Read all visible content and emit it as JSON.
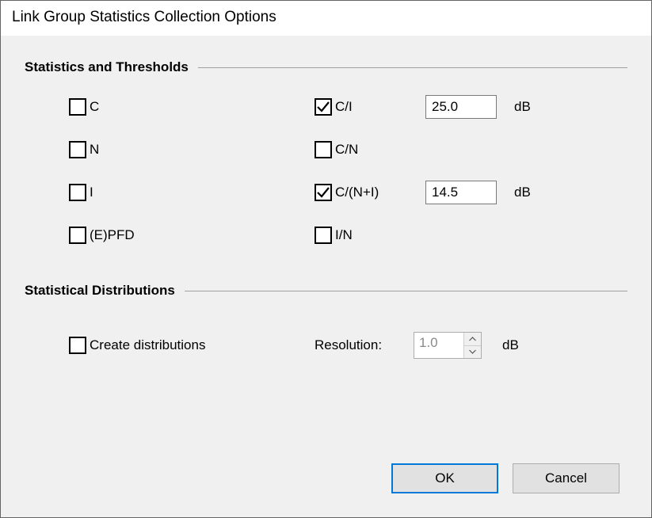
{
  "title": "Link Group Statistics Collection Options",
  "sections": {
    "stats": {
      "title": "Statistics and Thresholds",
      "left": [
        {
          "label": "C",
          "checked": false
        },
        {
          "label": "N",
          "checked": false
        },
        {
          "label": "I",
          "checked": false
        },
        {
          "label": "(E)PFD",
          "checked": false
        }
      ],
      "right": [
        {
          "label": "C/I",
          "checked": true,
          "value": "25.0",
          "unit": "dB"
        },
        {
          "label": "C/N",
          "checked": false
        },
        {
          "label": "C/(N+I)",
          "checked": true,
          "value": "14.5",
          "unit": "dB"
        },
        {
          "label": "I/N",
          "checked": false
        }
      ]
    },
    "dist": {
      "title": "Statistical Distributions",
      "create_label": "Create distributions",
      "create_checked": false,
      "resolution_label": "Resolution:",
      "resolution_value": "1.0",
      "resolution_unit": "dB"
    }
  },
  "buttons": {
    "ok": "OK",
    "cancel": "Cancel"
  }
}
